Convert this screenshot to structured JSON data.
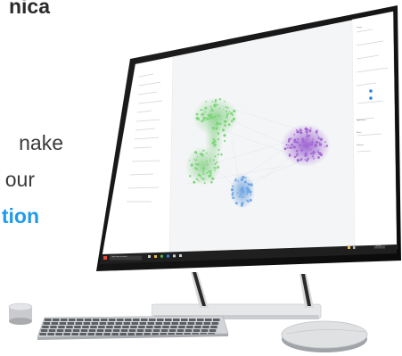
{
  "hero": {
    "line1": "nica",
    "line2": "nake",
    "line3": "our",
    "line4": "tion"
  },
  "app": {
    "panel_labels": [
      "Layout",
      "Appearance",
      "Filters",
      "Statistics"
    ],
    "taskbar_search": "Type here to search",
    "clock": "12:00"
  },
  "colors": {
    "accent_blue": "#1e9be8",
    "cluster_green": "#7ed67a",
    "cluster_purple": "#a66bd6",
    "cluster_blue": "#6fa8e6",
    "taskbar": "#1f1f1f"
  },
  "icons": [
    "windows-start-icon",
    "search-icon",
    "taskbar-app-icon",
    "chrome-icon",
    "folder-icon"
  ]
}
